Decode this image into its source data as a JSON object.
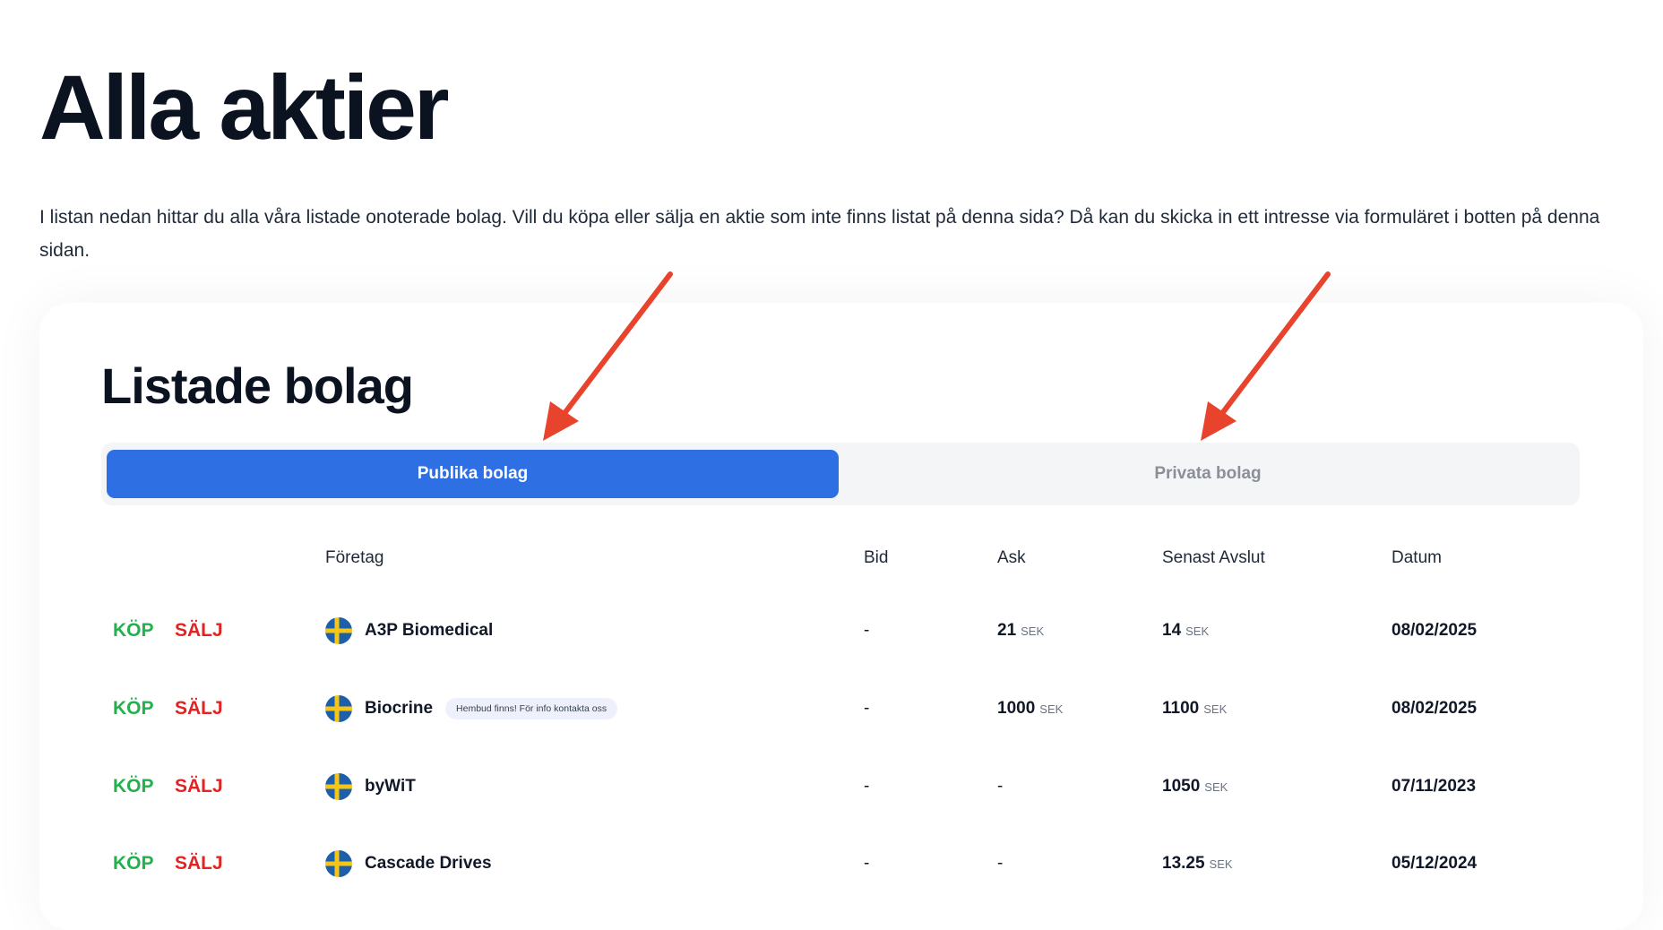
{
  "page": {
    "title": "Alla aktier",
    "intro": "I listan nedan hittar du alla våra listade onoterade bolag. Vill du köpa eller sälja en aktie som inte finns listat på denna sida? Då kan du skicka in ett intresse via formuläret i botten på denna sidan."
  },
  "section": {
    "title": "Listade bolag",
    "tabs": [
      {
        "label": "Publika bolag",
        "active": true
      },
      {
        "label": "Privata bolag",
        "active": false
      }
    ]
  },
  "table": {
    "columns": {
      "company": "Företag",
      "bid": "Bid",
      "ask": "Ask",
      "last": "Senast Avslut",
      "date": "Datum"
    },
    "buy_label": "KÖP",
    "sell_label": "SÄLJ",
    "unit": "SEK",
    "rows": [
      {
        "company": "A3P Biomedical",
        "badge": "",
        "bid": "-",
        "ask": "21",
        "last": "14",
        "date": "08/02/2025"
      },
      {
        "company": "Biocrine",
        "badge": "Hembud finns! För info kontakta oss",
        "bid": "-",
        "ask": "1000",
        "last": "1100",
        "date": "08/02/2025"
      },
      {
        "company": "byWiT",
        "badge": "",
        "bid": "-",
        "ask": "-",
        "last": "1050",
        "date": "07/11/2023"
      },
      {
        "company": "Cascade Drives",
        "badge": "",
        "bid": "-",
        "ask": "-",
        "last": "13.25",
        "date": "05/12/2024"
      }
    ]
  },
  "colors": {
    "accent": "#2f6fe4",
    "buy": "#22b14c",
    "sell": "#e02424",
    "annotation_arrow": "#e8432d"
  },
  "icons": {
    "flag": "sweden-flag-icon",
    "annotation": "red-arrow-icon"
  }
}
